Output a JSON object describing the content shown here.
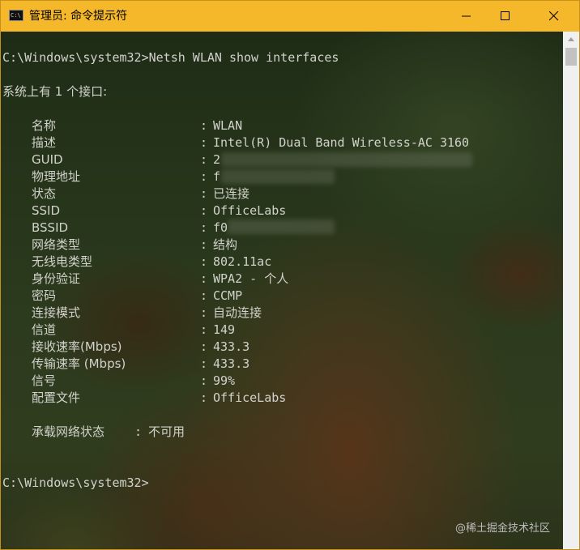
{
  "window": {
    "title": "管理员: 命令提示符",
    "app_icon_text": "C:\\",
    "controls": {
      "minimize": "minimize-icon",
      "maximize": "maximize-icon",
      "close": "close-icon"
    },
    "titlebar_color": "#f5b82b"
  },
  "console": {
    "prompt1": "C:\\Windows\\system32>Netsh WLAN show interfaces",
    "summary": "系统上有 1 个接口:",
    "fields": [
      {
        "label": "名称",
        "value": "WLAN"
      },
      {
        "label": "描述",
        "value": "Intel(R) Dual Band Wireless-AC 3160"
      },
      {
        "label": "GUID",
        "value": "2"
      },
      {
        "label": "物理地址",
        "value": "f"
      },
      {
        "label": "状态",
        "value": "已连接"
      },
      {
        "label": "SSID",
        "value": "OfficeLabs"
      },
      {
        "label": "BSSID",
        "value": "f0"
      },
      {
        "label": "网络类型",
        "value": "结构"
      },
      {
        "label": "无线电类型",
        "value": "802.11ac"
      },
      {
        "label": "身份验证",
        "value": "WPA2 - 个人"
      },
      {
        "label": "密码",
        "value": "CCMP"
      },
      {
        "label": "连接模式",
        "value": "自动连接"
      },
      {
        "label": "信道",
        "value": "149"
      },
      {
        "label": "接收速率(Mbps)",
        "value": "433.3"
      },
      {
        "label": "传输速率 (Mbps)",
        "value": "433.3"
      },
      {
        "label": "信号",
        "value": "99%"
      },
      {
        "label": "配置文件",
        "value": "OfficeLabs"
      }
    ],
    "colon": ":",
    "hosted_network": {
      "label": "承载网络状态",
      "colon": ":",
      "value": "不可用"
    },
    "prompt2": "C:\\Windows\\system32>"
  },
  "watermark": "@稀土掘金技术社区",
  "colors": {
    "text": "#d2d2cc",
    "scrollbar": "#f0f0f0"
  }
}
